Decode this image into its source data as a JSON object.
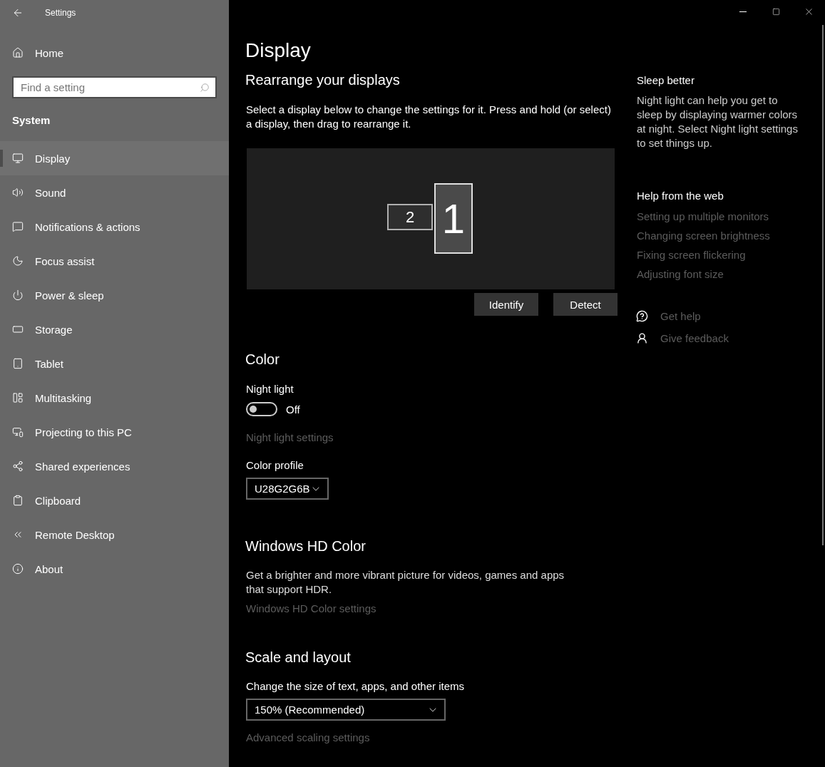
{
  "window": {
    "title": "Settings"
  },
  "sidebar": {
    "home": "Home",
    "search": {
      "placeholder": "Find a setting"
    },
    "section": "System",
    "items": [
      {
        "label": "Display",
        "selected": true
      },
      {
        "label": "Sound",
        "selected": false
      },
      {
        "label": "Notifications & actions",
        "selected": false
      },
      {
        "label": "Focus assist",
        "selected": false
      },
      {
        "label": "Power & sleep",
        "selected": false
      },
      {
        "label": "Storage",
        "selected": false
      },
      {
        "label": "Tablet",
        "selected": false
      },
      {
        "label": "Multitasking",
        "selected": false
      },
      {
        "label": "Projecting to this PC",
        "selected": false
      },
      {
        "label": "Shared experiences",
        "selected": false
      },
      {
        "label": "Clipboard",
        "selected": false
      },
      {
        "label": "Remote Desktop",
        "selected": false
      },
      {
        "label": "About",
        "selected": false
      }
    ]
  },
  "page_title": "Display",
  "rearrange": {
    "heading": "Rearrange your displays",
    "description": "Select a display below to change the settings for it. Press and hold (or select) a display, then drag to rearrange it.",
    "monitors": [
      {
        "label": "2",
        "selected": false
      },
      {
        "label": "1",
        "selected": true
      }
    ],
    "buttons": [
      "Identify",
      "Detect"
    ]
  },
  "color": {
    "heading": "Color",
    "night_light": {
      "label": "Night light",
      "on": false,
      "state_text": "Off"
    },
    "night_light_settings": "Night light settings",
    "profile_label": "Color profile",
    "profile_value": "U28G2G6B"
  },
  "hd_color": {
    "heading": "Windows HD Color",
    "description": "Get a brighter and more vibrant picture for videos, games and apps that support HDR.",
    "link": "Windows HD Color settings"
  },
  "scale": {
    "heading": "Scale and layout",
    "label": "Change the size of text, apps, and other items",
    "value": "150% (Recommended)",
    "link": "Advanced scaling settings"
  },
  "aside": {
    "sleep_heading": "Sleep better",
    "sleep_text": "Night light can help you get to sleep by displaying warmer colors at night. Select Night light settings to set things up.",
    "help_heading": "Help from the web",
    "help_links": [
      "Setting up multiple monitors",
      "Changing screen brightness",
      "Fixing screen flickering",
      "Adjusting font size"
    ],
    "actions": [
      "Get help",
      "Give feedback"
    ]
  }
}
